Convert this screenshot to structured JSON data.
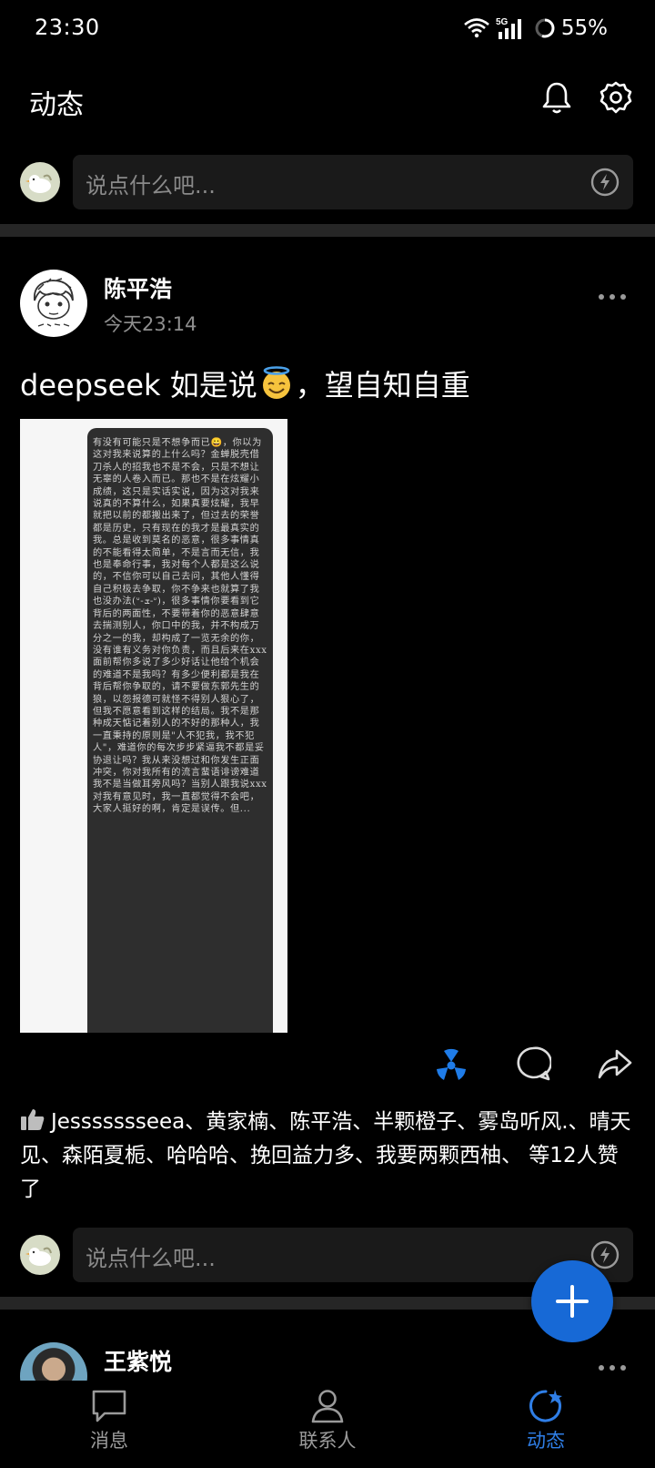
{
  "status_bar": {
    "time": "23:30",
    "network": "5G",
    "battery": "55%"
  },
  "header": {
    "title": "动态",
    "icons": [
      "bell-icon",
      "gear-icon"
    ]
  },
  "top_comment": {
    "placeholder": "说点什么吧..."
  },
  "post": {
    "author": "陈平浩",
    "time": "今天23:14",
    "text_before": "deepseek 如是说",
    "text_after": "，望自知自重",
    "image_text": "有没有可能只是不想争而已😀，你以为这对我来说算的上什么吗？金蝉脱壳借刀杀人的招我也不是不会，只是不想让无辜的人卷入而已。那也不是在炫耀小成绩，这只是实话实说，因为这对我来说真的不算什么，如果真要炫耀，我早就把以前的都搬出来了，但过去的荣誉都是历史，只有现在的我才是最真实的我。总是收到莫名的恶意，很多事情真的不能看得太简单，不是言而无信，我也是奉命行事，我对每个人都是这么说的，不信你可以自己去问，其他人懂得自己积极去争取，你不争来也就算了我也没办法(ᐡ-ܫ-ᐡ)，很多事情你要看到它背后的两面性，不要带着你的恶意肆意去揣测别人，你口中的我，并不构成万分之一的我，却构成了一览无余的你，没有谁有义务对你负责，而且后来在xxx面前帮你多说了多少好话让他给个机会的难道不是我吗？有多少便利都是我在背后帮你争取的，请不要做东郭先生的狼，以怨报德可就怪不得别人狠心了，但我不愿意看到这样的结局。我不是那种成天惦记着别人的不好的那种人，我一直秉持的原则是\"人不犯我，我不犯人\"，难道你的每次步步紧逼我不都是妥协退让吗？我从来没想过和你发生正面冲突，你对我所有的流言蜚语诽谤难道我不是当做耳旁风吗？当别人跟我说xxx对我有意见时，我一直都觉得不会吧，大家人挺好的啊，肯定是误传。但...",
    "likes_text": "Jessssssseea、黄家楠、陈平浩、半颗橙子、雾岛听风.、晴天见、森陌夏栀、哈哈哈、挽回益力多、我要两颗西柚、 等12人赞了"
  },
  "post_comment": {
    "placeholder": "说点什么吧..."
  },
  "next_post": {
    "author": "王紫悦"
  },
  "bottom_nav": {
    "items": [
      {
        "label": "消息",
        "icon": "message-icon",
        "active": false
      },
      {
        "label": "联系人",
        "icon": "contacts-icon",
        "active": false
      },
      {
        "label": "动态",
        "icon": "moments-icon",
        "active": true
      }
    ]
  },
  "colors": {
    "accent": "#1769d6",
    "active_nav": "#2f7ee6",
    "input_bg": "#1a1a1a",
    "divider": "#262626"
  }
}
